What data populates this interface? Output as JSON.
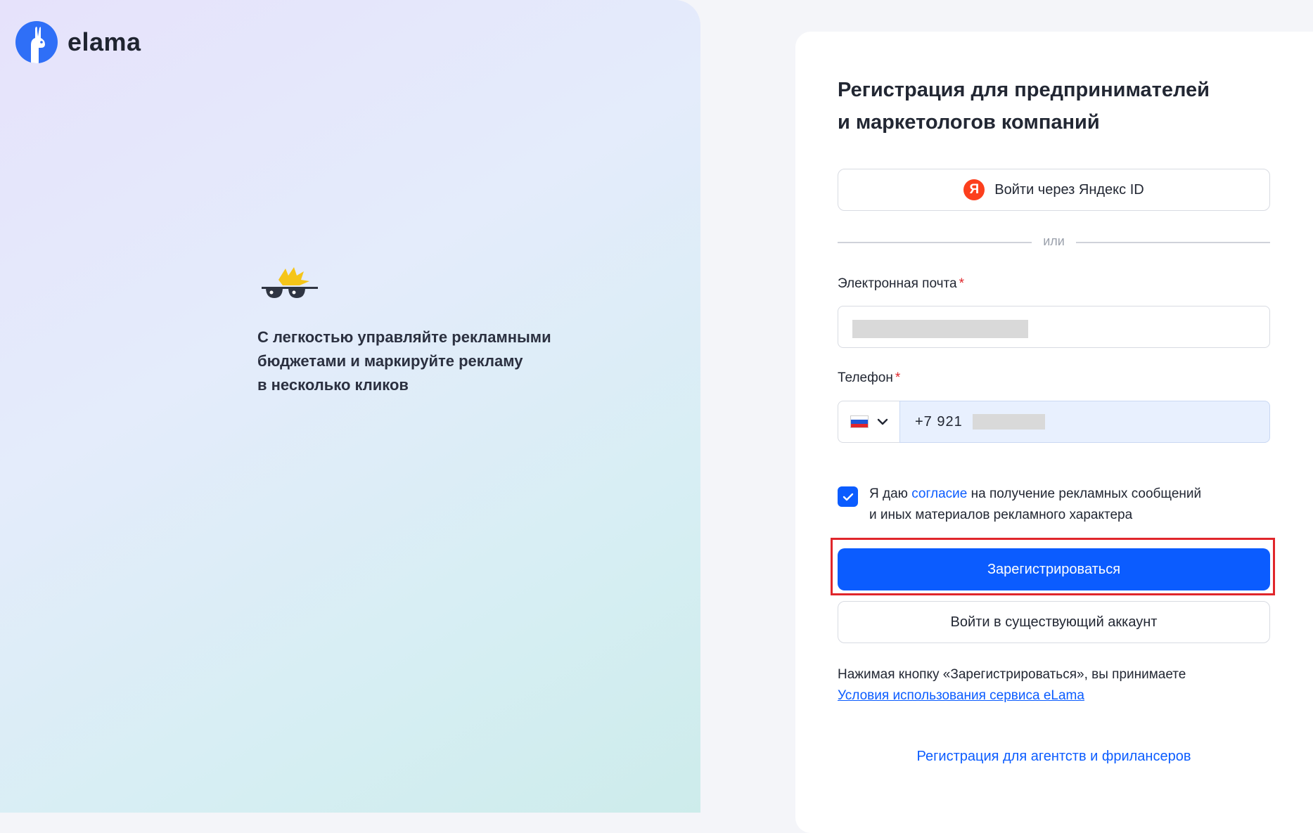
{
  "brand": {
    "name": "elama"
  },
  "promo": {
    "lines": [
      "С легкостью управляйте рекламными",
      "бюджетами и маркируйте рекламу",
      "в несколько кликов"
    ]
  },
  "form": {
    "title_lines": [
      "Регистрация для предпринимателей",
      "и маркетологов компаний"
    ],
    "yandex_button": "Войти через Яндекс ID",
    "yandex_icon": "Я",
    "divider_text": "или",
    "email": {
      "label": "Электронная почта",
      "required_mark": "*",
      "value": ""
    },
    "phone": {
      "label": "Телефон",
      "required_mark": "*",
      "country_flag": "russia-flag-icon",
      "value": "+7  921"
    },
    "consent": {
      "checked": true,
      "before": "Я даю ",
      "link": "согласие",
      "after": " на получение рекламных сообщений",
      "line2": "и иных материалов рекламного характера"
    },
    "register_button": "Зарегистрироваться",
    "login_button": "Войти в существующий аккаунт",
    "terms": {
      "line1": "Нажимая кнопку «Зарегистрироваться», вы принимаете",
      "link": "Условия использования сервиса eLama"
    },
    "agency_link": "Регистрация для агентств и фрилансеров"
  },
  "colors": {
    "accent": "#0b5cff",
    "required": "#e0262b",
    "yandex": "#fc3f1d"
  }
}
